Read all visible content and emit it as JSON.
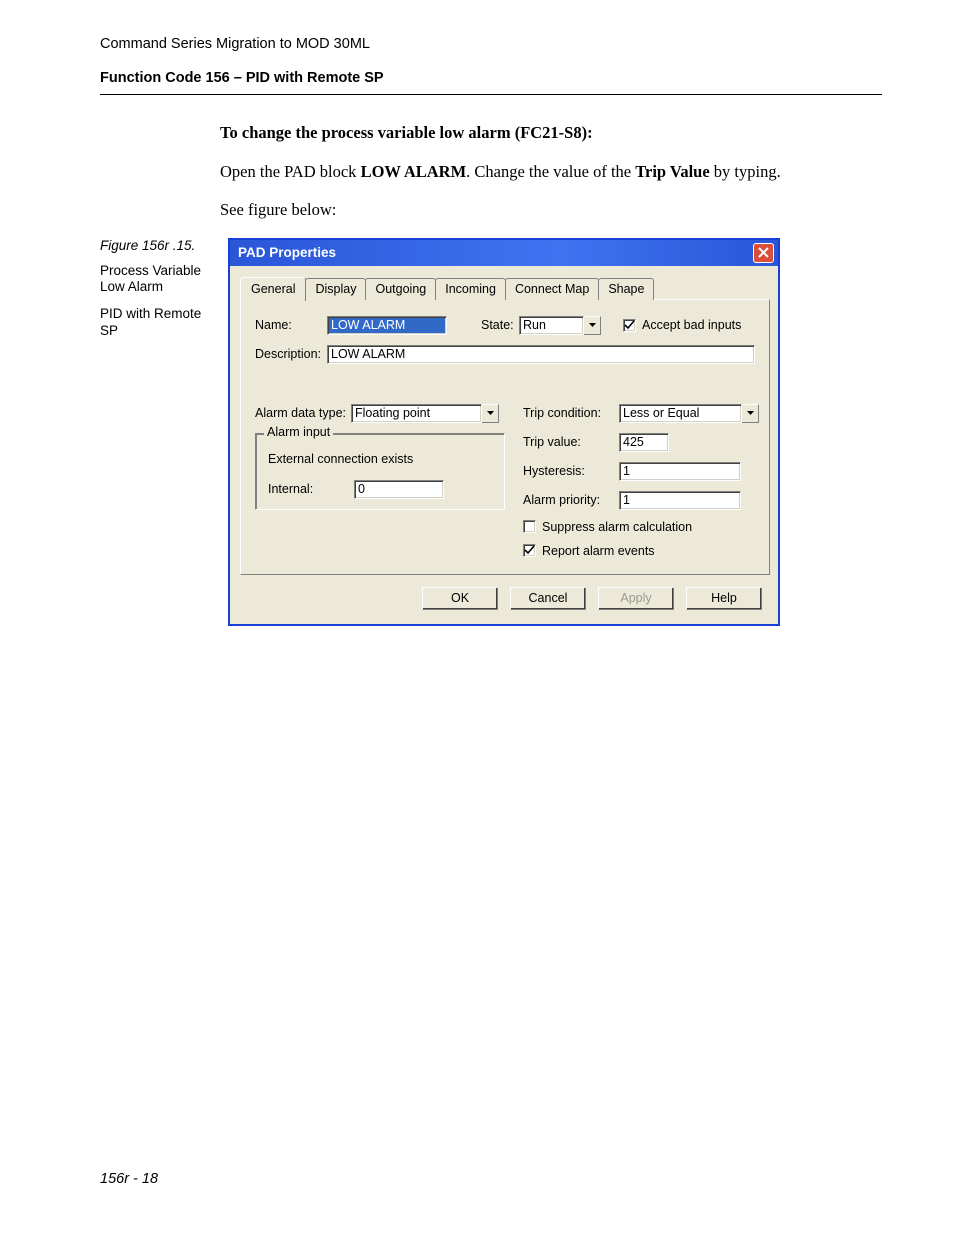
{
  "doc": {
    "header": "Command Series Migration to MOD 30ML",
    "subheader": "Function Code 156 – PID with Remote SP",
    "section_heading": "To change the process variable low alarm (FC21-S8):",
    "para1_pre": "Open the PAD block ",
    "para1_bold1": "LOW ALARM",
    "para1_mid": ". Change the value of the ",
    "para1_bold2": "Trip Value",
    "para1_post": " by typing.",
    "para2": "See figure below:",
    "page_number": "156r - 18"
  },
  "sidebar": {
    "fig_label": "Figure 156r .15.",
    "desc1": "Process Variable Low Alarm",
    "desc2": "PID with Remote SP"
  },
  "dialog": {
    "title": "PAD Properties",
    "tabs": [
      "General",
      "Display",
      "Outgoing",
      "Incoming",
      "Connect Map",
      "Shape"
    ],
    "active_tab": "General",
    "labels": {
      "name": "Name:",
      "state": "State:",
      "accept_bad": "Accept bad inputs",
      "description": "Description:",
      "alarm_data_type": "Alarm data type:",
      "alarm_input_legend": "Alarm input",
      "external_conn": "External connection exists",
      "internal": "Internal:",
      "trip_condition": "Trip condition:",
      "trip_value": "Trip value:",
      "hysteresis": "Hysteresis:",
      "alarm_priority": "Alarm priority:",
      "suppress": "Suppress alarm calculation",
      "report": "Report alarm events"
    },
    "values": {
      "name": "LOW ALARM",
      "state": "Run",
      "accept_bad_checked": true,
      "description": "LOW  ALARM",
      "alarm_data_type": "Floating point",
      "internal": "0",
      "trip_condition": "Less or Equal",
      "trip_value": "425",
      "hysteresis": "1",
      "alarm_priority": "1",
      "suppress_checked": false,
      "report_checked": true
    },
    "buttons": {
      "ok": "OK",
      "cancel": "Cancel",
      "apply": "Apply",
      "help": "Help"
    }
  }
}
